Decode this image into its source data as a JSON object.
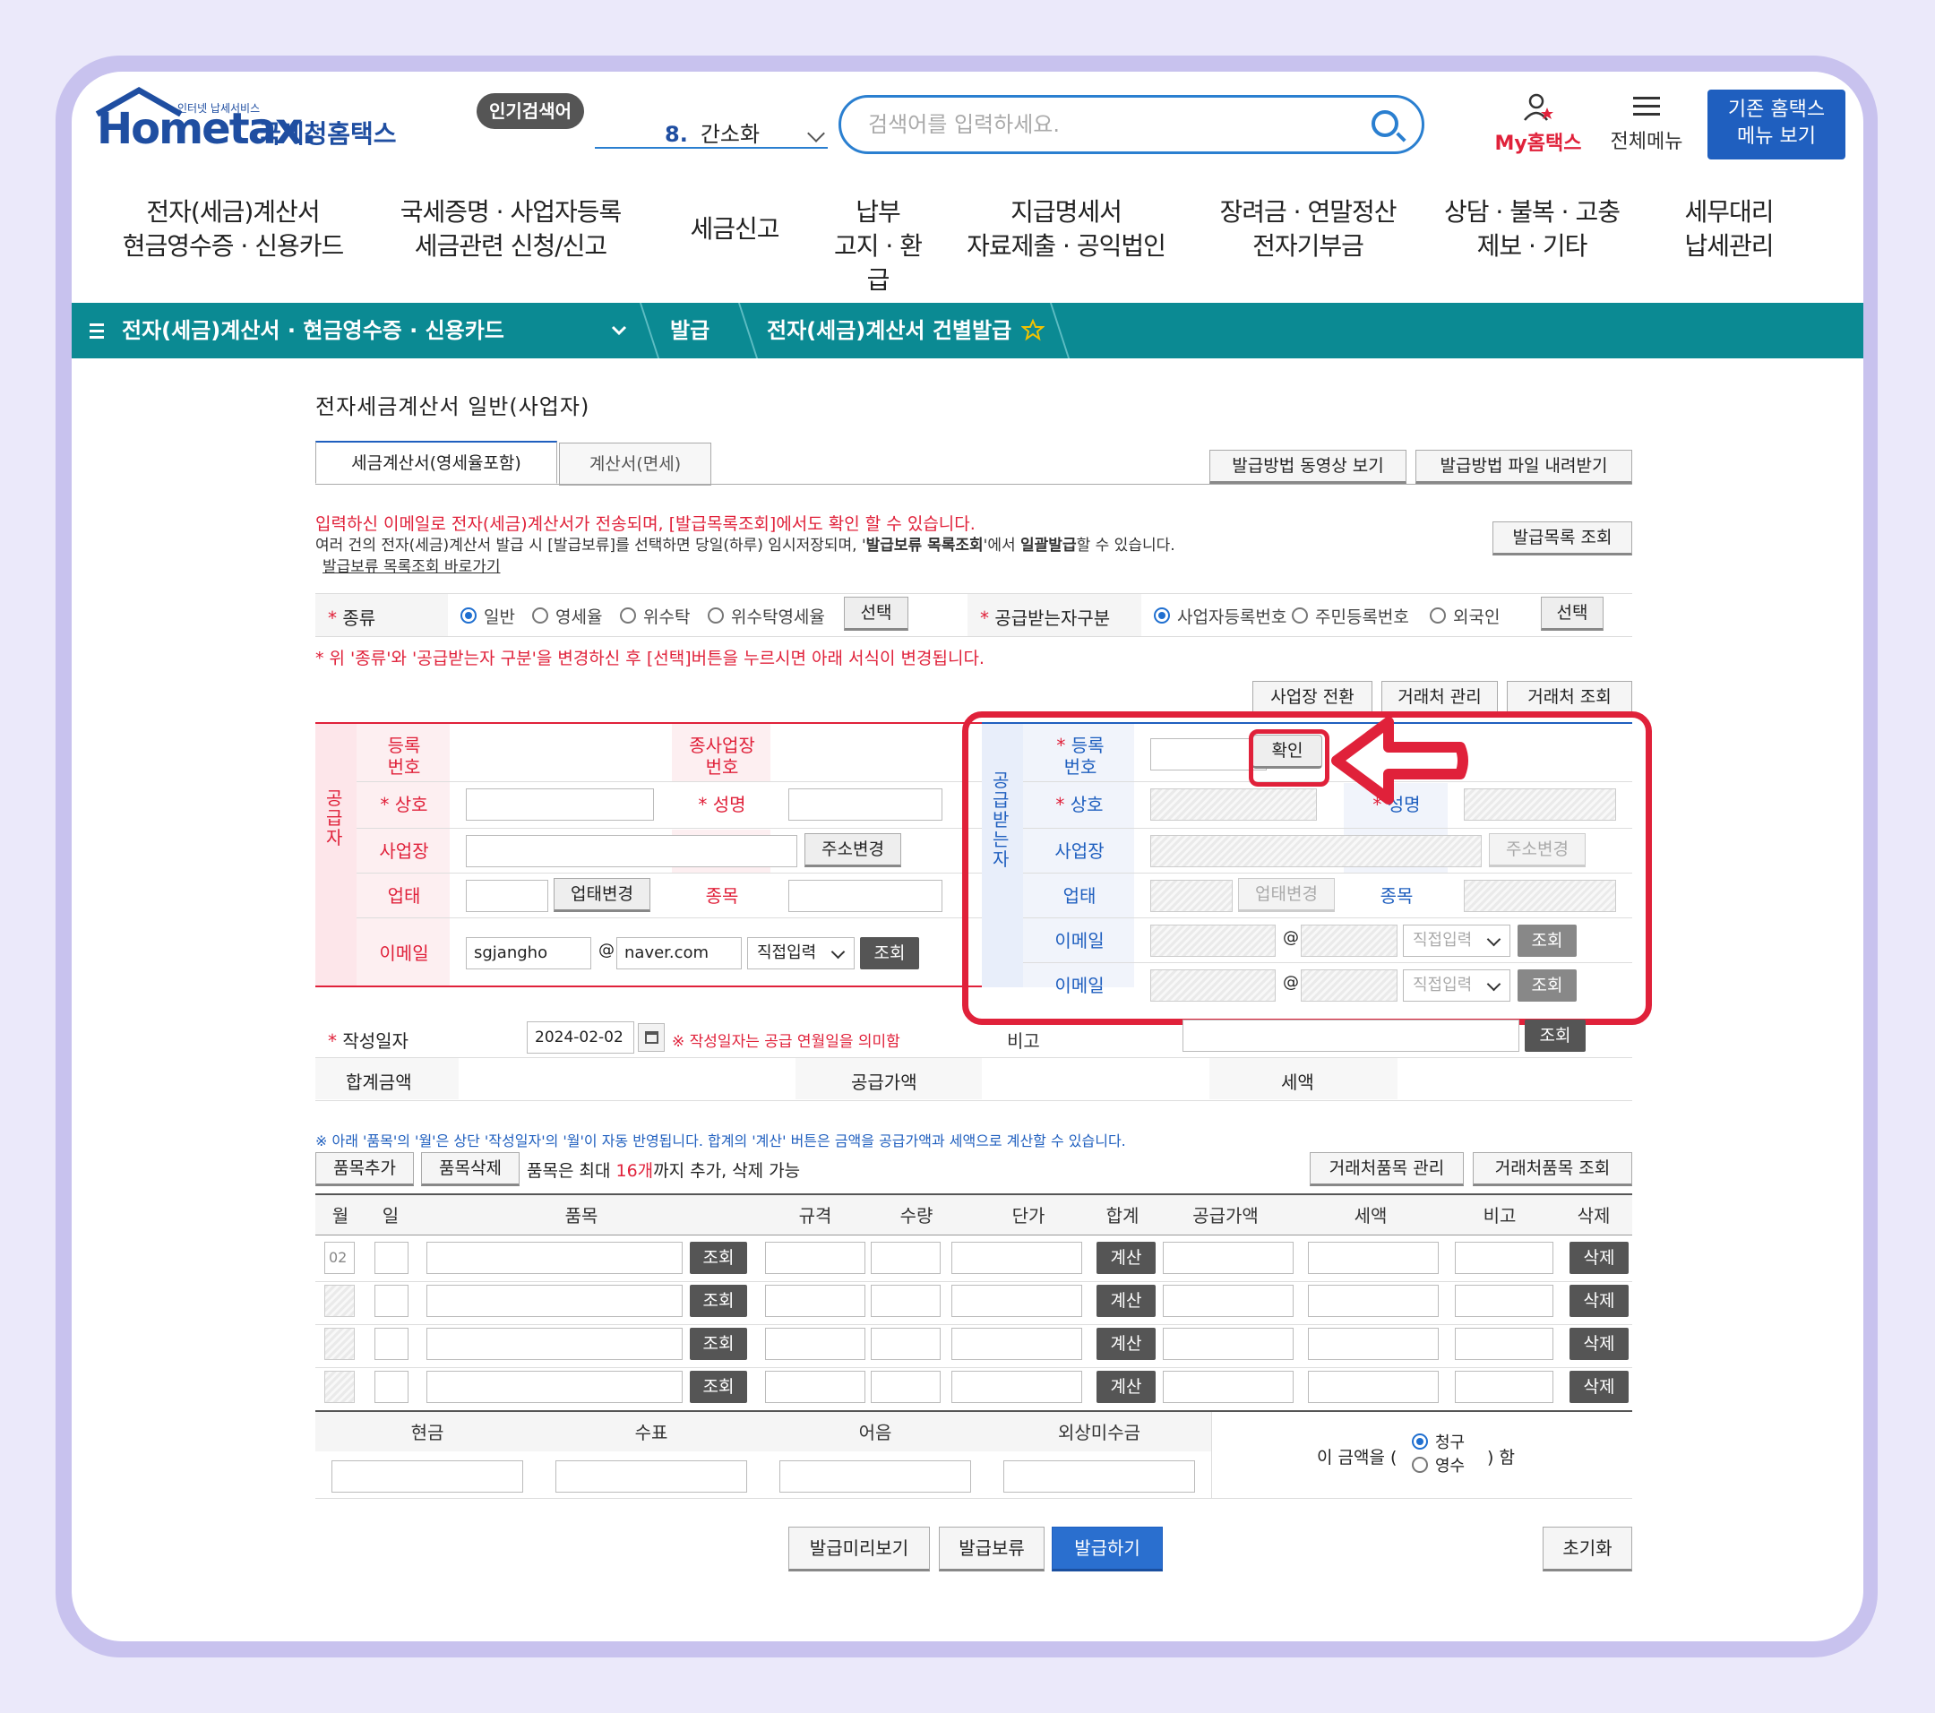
{
  "header": {
    "logo_text": "Hometax.",
    "logo_small": "인터넷 납세서비스",
    "logo_kr": "국세청홈택스",
    "popular_label": "인기검색어",
    "popular_rank": "8.",
    "popular_word": "간소화",
    "search_placeholder": "검색어를 입력하세요.",
    "my_hometax": "My홈택스",
    "all_menu": "전체메뉴",
    "old_menu_line1": "기존 홈택스",
    "old_menu_line2": "메뉴 보기"
  },
  "gnb": [
    {
      "l1": "전자(세금)계산서",
      "l2": "현금영수증 · 신용카드"
    },
    {
      "l1": "국세증명 · 사업자등록",
      "l2": "세금관련 신청/신고"
    },
    {
      "l1": "세금신고",
      "l2": ""
    },
    {
      "l1": "납부",
      "l2": "고지 · 환급"
    },
    {
      "l1": "지급명세서",
      "l2": "자료제출 · 공익법인"
    },
    {
      "l1": "장려금 · 연말정산",
      "l2": "전자기부금"
    },
    {
      "l1": "상담 · 불복 · 고충",
      "l2": "제보 · 기타"
    },
    {
      "l1": "세무대리",
      "l2": "납세관리"
    }
  ],
  "breadcrumb": {
    "menu": "전자(세금)계산서 · 현금영수증 · 신용카드",
    "step2": "발급",
    "step3": "전자(세금)계산서 건별발급"
  },
  "page": {
    "title": "전자세금계산서 일반(사업자)",
    "tab1": "세금계산서(영세율포함)",
    "tab2": "계산서(면세)",
    "video_btn": "발급방법 동영상 보기",
    "file_btn": "발급방법 파일 내려받기",
    "notice1": "입력하신 이메일로 전자(세금)계산서가 전송되며, [발급목록조회]에서도 확인 할 수 있습니다.",
    "notice2a": "여러 건의 전자(세금)계산서 발급 시 [발급보류]를 선택하면 당일(하루) 임시저장되며, '",
    "notice2b": "발급보류 목록조회",
    "notice2c": "'에서 ",
    "notice2d": "일괄발급",
    "notice2e": "할 수 있습니다.",
    "hold_link": "발급보류 목록조회 바로가기",
    "list_btn": "발급목록 조회",
    "type_label": "종류",
    "type_opts": [
      "일반",
      "영세율",
      "위수탁",
      "위수탁영세율"
    ],
    "select_btn": "선택",
    "recv_type_label": "공급받는자구분",
    "recv_opts": [
      "사업자등록번호",
      "주민등록번호",
      "외국인"
    ],
    "change_notice": "* 위 '종류'와 '공급받는자 구분'을 변경하신 후 [선택]버튼을 누르시면 아래 서식이 변경됩니다.",
    "biz_switch": "사업장 전환",
    "partner_mgmt": "거래처 관리",
    "partner_search": "거래처 조회"
  },
  "supplier": {
    "side": "공급자",
    "reg_no": "등록\n번호",
    "sub_biz": "종사업장\n번호",
    "name": "상호",
    "rep": "성명",
    "addr": "사업장",
    "addr_btn": "주소변경",
    "biz_type": "업태",
    "biz_btn": "업태변경",
    "item": "종목",
    "email": "이메일",
    "email_id": "sgjangho",
    "at": "@",
    "email_domain": "naver.com",
    "direct": "직접입력",
    "lookup": "조회"
  },
  "receiver": {
    "side": "공급받는자",
    "reg_no": "등록\n번호",
    "confirm": "확인",
    "name": "상호",
    "rep": "성명",
    "addr": "사업장",
    "addr_btn": "주소변경",
    "biz_type": "업태",
    "biz_btn": "업태변경",
    "item": "종목",
    "email1": "이메일",
    "email2": "이메일",
    "at": "@",
    "direct": "직접입력",
    "lookup": "조회"
  },
  "summary": {
    "date_label": "작성일자",
    "date_value": "2024-02-02",
    "date_note": "※ 작성일자는 공급 연월일을 의미함",
    "memo": "비고",
    "memo_btn": "조회",
    "total": "합계금액",
    "supply": "공급가액",
    "tax": "세액"
  },
  "items": {
    "note": "※ 아래 '품목'의 '월'은 상단 '작성일자'의 '월'이 자동 반영됩니다. 합계의 '계산' 버튼은 금액을 공급가액과 세액으로 계산할 수 있습니다.",
    "add": "품목추가",
    "del": "품목삭제",
    "limit_a": "품목은 최대 ",
    "limit_b": "16개",
    "limit_c": "까지 추가, 삭제 가능",
    "partner_items_mgmt": "거래처품목 관리",
    "partner_items_search": "거래처품목 조회",
    "headers": [
      "월",
      "일",
      "품목",
      "규격",
      "수량",
      "단가",
      "합계",
      "공급가액",
      "세액",
      "비고",
      "삭제"
    ],
    "month_value": "02",
    "lookup": "조회",
    "calc": "계산",
    "delete": "삭제"
  },
  "payment": {
    "cash": "현금",
    "check": "수표",
    "note": "어음",
    "credit": "외상미수금",
    "amount_a": "이 금액을 (",
    "claim": "청구",
    "receipt": "영수",
    "amount_b": ") 함"
  },
  "actions": {
    "preview": "발급미리보기",
    "hold": "발급보류",
    "issue": "발급하기",
    "reset": "초기화"
  },
  "colors": {
    "accent": "#0b8a93",
    "highlight": "#e0213a",
    "primary": "#1f5fbf"
  }
}
